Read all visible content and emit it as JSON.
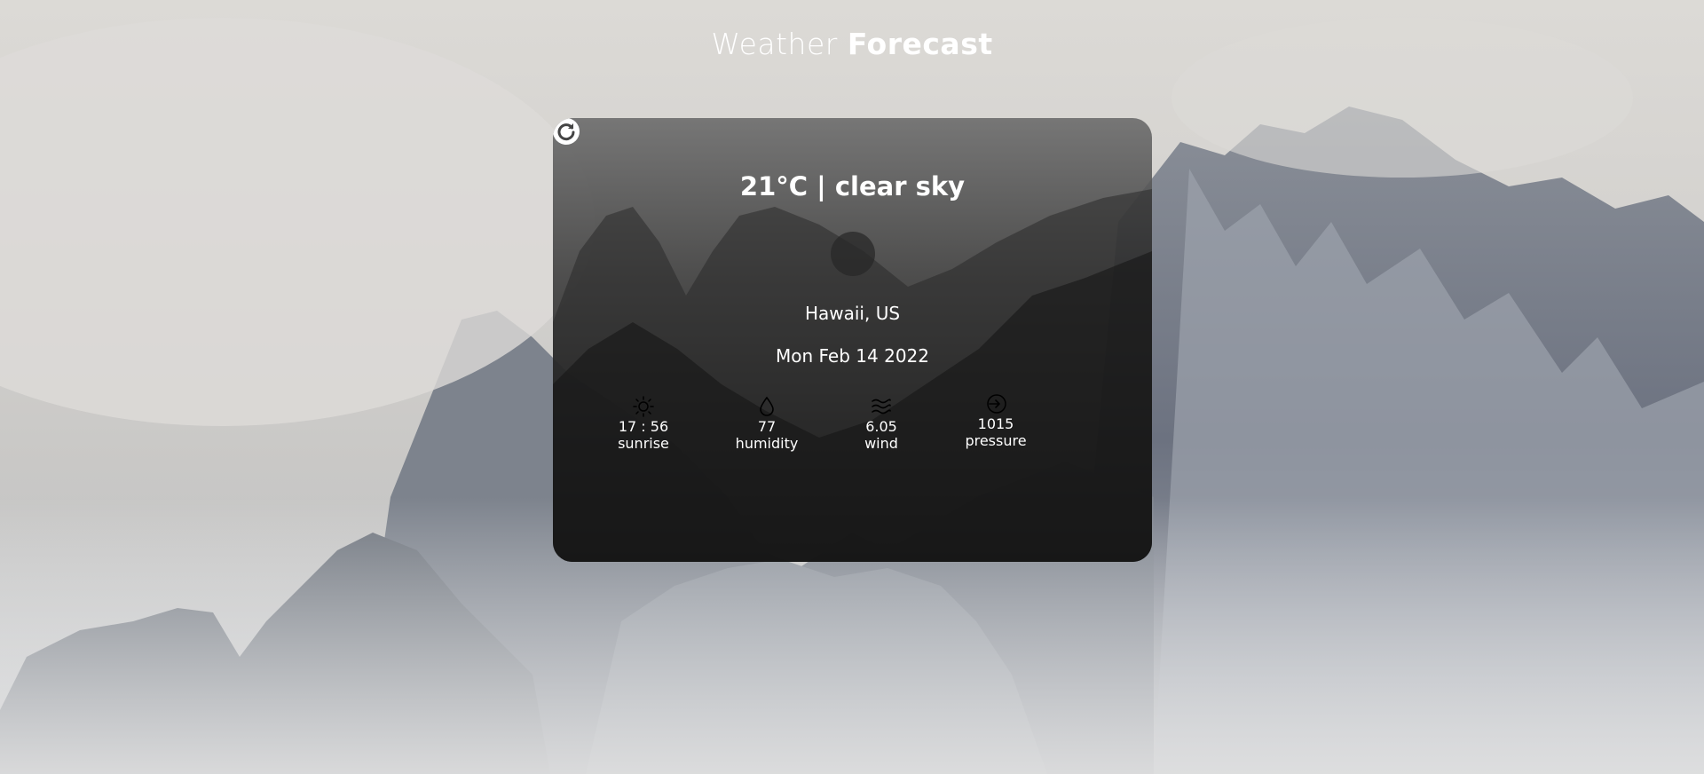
{
  "header": {
    "title_light": "Weather",
    "title_bold": "Forecast"
  },
  "weather": {
    "headline": "21°C | clear sky",
    "location": "Hawaii, US",
    "date": "Mon Feb 14 2022",
    "icon": "weather-condition-icon"
  },
  "stats": [
    {
      "icon": "sun-icon",
      "value": "17 : 56",
      "label": "sunrise"
    },
    {
      "icon": "water-drop-icon",
      "value": "77",
      "label": "humidity"
    },
    {
      "icon": "wind-waves-icon",
      "value": "6.05",
      "label": "wind"
    },
    {
      "icon": "arrow-circle-right-icon",
      "value": "1015",
      "label": "pressure"
    }
  ],
  "controls": {
    "refresh_icon": "refresh-icon"
  },
  "colors": {
    "text": "#ffffff",
    "card_top": "#6e6e6e",
    "card_bottom": "#050505"
  }
}
